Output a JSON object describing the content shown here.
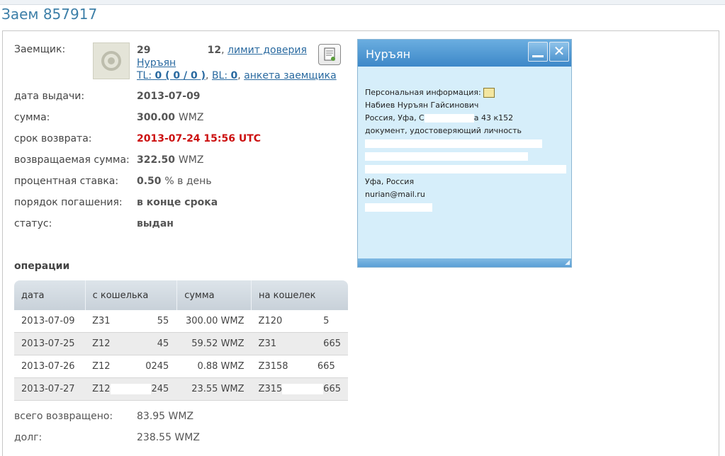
{
  "page": {
    "title": "Заем 857917"
  },
  "borrower": {
    "label": "Заемщик:",
    "id_start": "29",
    "id_end": "12",
    "sep1": ",",
    "trust_limit": "лимит доверия",
    "name": "Нуръян",
    "tl_label": "TL:",
    "tl_value": "0 ( 0 / 0 )",
    "bl_label": "BL:",
    "bl_value": "0",
    "profile": "анкета заемщика"
  },
  "fields": {
    "issue_date_label": "дата выдачи:",
    "issue_date": "2013-07-09",
    "amount_label": "сумма:",
    "amount": "300.00",
    "amount_unit": "WMZ",
    "due_label": "срок возврата:",
    "due": "2013-07-24 15:56 UTC",
    "return_label": "возвращаемая сумма:",
    "return_amount": "322.50",
    "return_unit": "WMZ",
    "rate_label": "процентная ставка:",
    "rate": "0.50",
    "rate_unit": "% в день",
    "order_label": "порядок погашения:",
    "order": "в конце срока",
    "status_label": "статус:",
    "status": "выдан"
  },
  "operations": {
    "title": "операции",
    "headers": [
      "дата",
      "с кошелька",
      "сумма",
      "на кошелек"
    ],
    "rows": [
      [
        "2013-07-09",
        "Z31",
        "55",
        "300.00 WMZ",
        "Z120",
        "5"
      ],
      [
        "2013-07-25",
        "Z12",
        "45",
        "59.52 WMZ",
        "Z31",
        "665"
      ],
      [
        "2013-07-26",
        "Z12",
        "0245",
        "0.88 WMZ",
        "Z3158",
        "665"
      ],
      [
        "2013-07-27",
        "Z12",
        "245",
        "23.55 WMZ",
        "Z315",
        "665"
      ]
    ]
  },
  "summary": {
    "returned_label": "всего возвращено:",
    "returned_value": "83.95 WMZ",
    "debt_label": "долг:",
    "debt_value": "238.55 WMZ"
  },
  "popup": {
    "title": "Нуръян",
    "info_label": "Персональная информация:",
    "full_name": "Набиев Нуръян Гайсинович",
    "address_start": "Россия, Уфа, С",
    "address_end": "а 43 к152",
    "doc_label": "документ, удостоверяющий личность",
    "city": "Уфа, Россия",
    "email": "nurian@mail.ru",
    "close_glyph": "✕"
  },
  "icons": {
    "doc_button": "certificate-icon",
    "avatar": "avatar-icon",
    "info": "id-card-icon"
  },
  "colors": {
    "link": "#2a6aa0",
    "title": "#3d7fa8",
    "due": "#cc1111",
    "popup_header": "#4f95cf"
  }
}
